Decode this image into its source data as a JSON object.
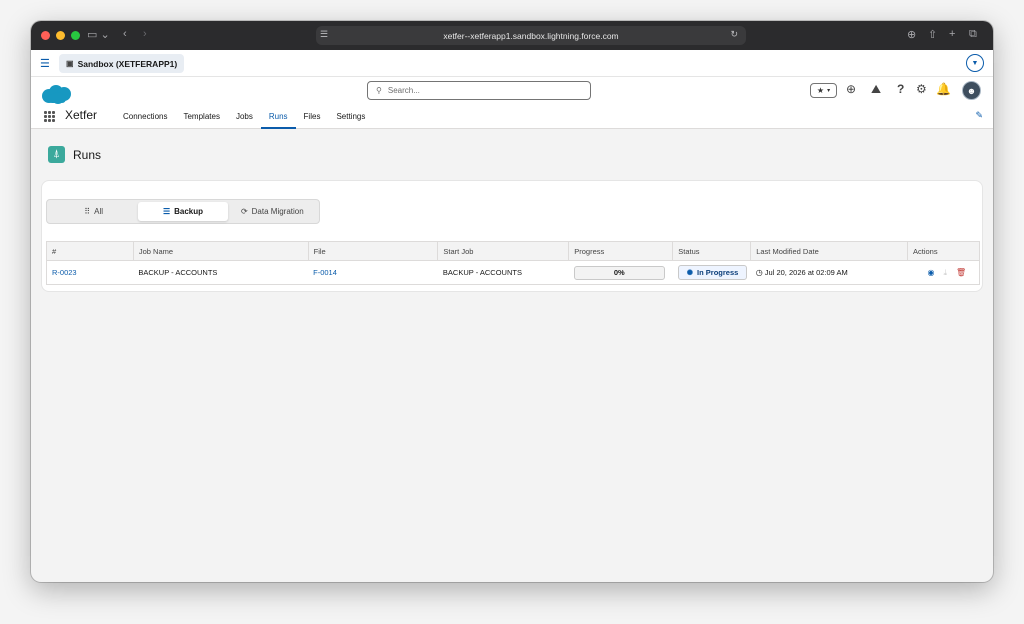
{
  "browser": {
    "url": "xetfer--xetferapp1.sandbox.lightning.force.com"
  },
  "sf_bar": {
    "sandbox_label": "Sandbox (XETFERAPP1)"
  },
  "header": {
    "search_placeholder": "Search...",
    "app_name": "Xetfer",
    "nav": [
      "Connections",
      "Templates",
      "Jobs",
      "Runs",
      "Files",
      "Settings"
    ],
    "active_nav": "Runs"
  },
  "page": {
    "title": "Runs"
  },
  "filters": {
    "all": "All",
    "backup": "Backup",
    "data_migration": "Data Migration",
    "active": "Backup"
  },
  "table": {
    "columns": [
      "#",
      "Job Name",
      "File",
      "Start Job",
      "Progress",
      "Status",
      "Last Modified Date",
      "Actions"
    ],
    "rows": [
      {
        "id": "R-0023",
        "job_name": "BACKUP - ACCOUNTS",
        "file": "F-0014",
        "start_job": "BACKUP - ACCOUNTS",
        "progress_label": "0%",
        "progress_value": 0,
        "status": "In Progress",
        "modified": "Jul 20, 2026 at 02:09 AM"
      }
    ]
  },
  "colors": {
    "accent": "#0b5cab",
    "runs_icon": "#3ba99c",
    "delete": "#c23934"
  },
  "icons": [
    "menu-icon",
    "search-icon",
    "star-icon",
    "add-icon",
    "trailhead-icon",
    "help-icon",
    "gear-icon",
    "bell-icon",
    "waffle-icon",
    "pencil-icon",
    "runs-icon",
    "grid-icon",
    "database-icon",
    "sync-icon",
    "spinner-icon",
    "clock-icon",
    "view-icon",
    "download-icon",
    "delete-icon"
  ]
}
